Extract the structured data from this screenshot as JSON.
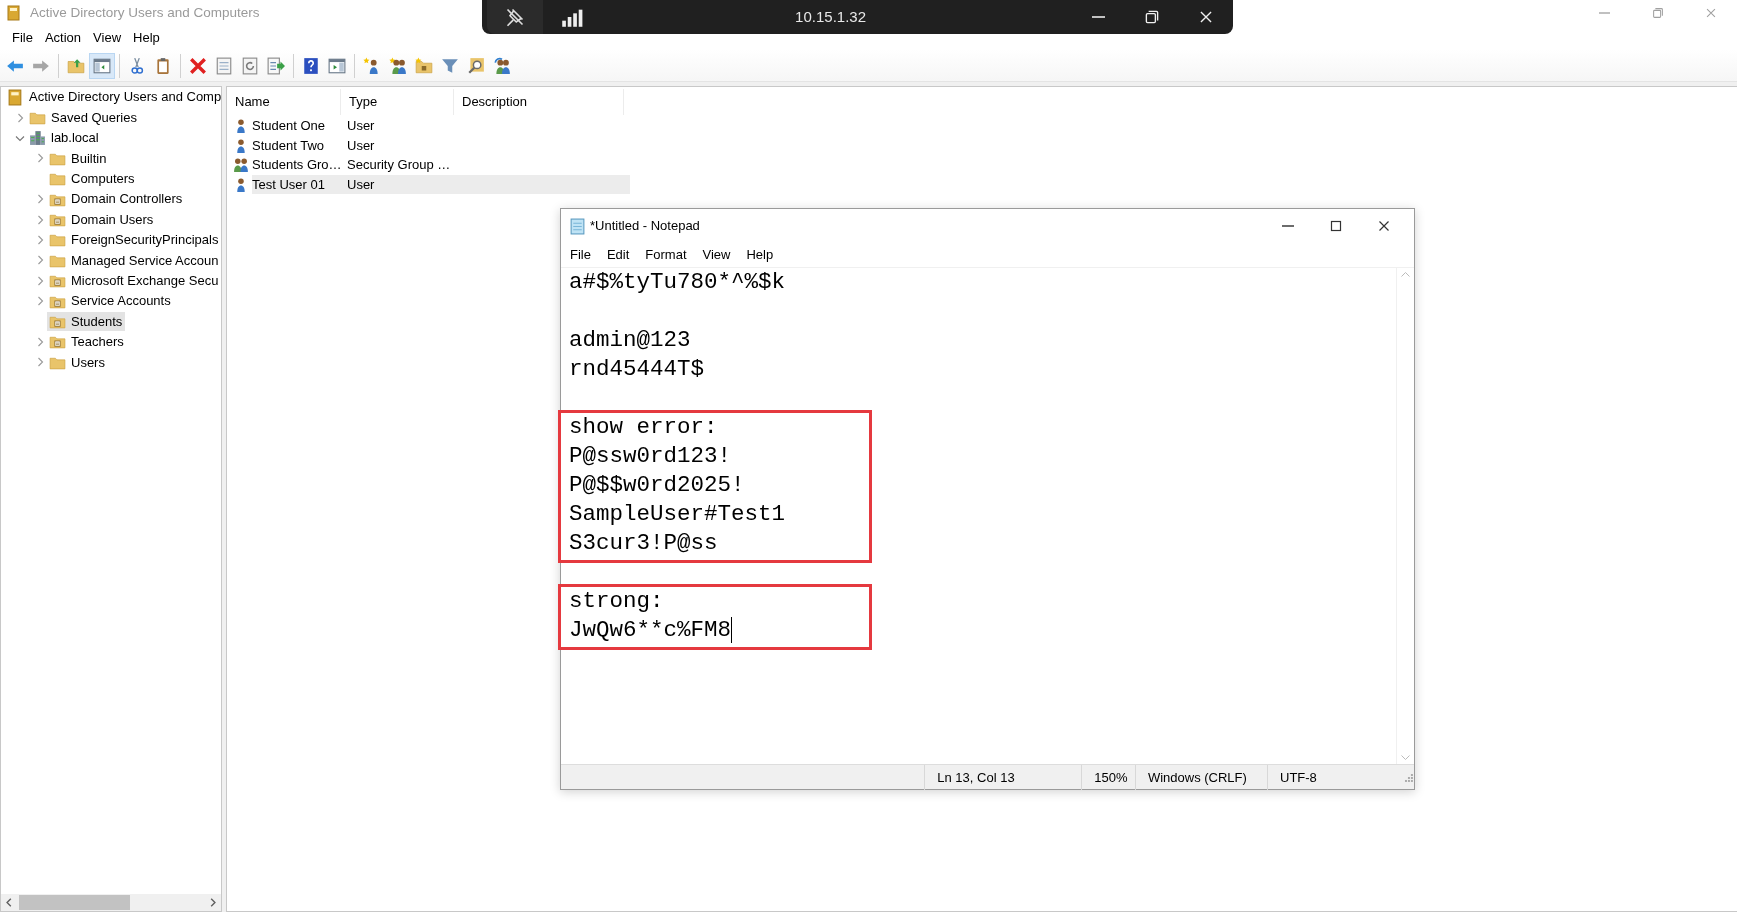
{
  "window": {
    "title": "Active Directory Users and Computers"
  },
  "remote_bar": {
    "address": "10.15.1.32"
  },
  "menu": [
    "File",
    "Action",
    "View",
    "Help"
  ],
  "toolbar_groups": [
    [
      {
        "kind": "back",
        "selected": false,
        "disabled": false
      },
      {
        "kind": "forward",
        "selected": false,
        "disabled": true
      }
    ],
    [
      {
        "kind": "up",
        "selected": false,
        "disabled": false
      },
      {
        "kind": "tree",
        "selected": true,
        "disabled": false
      }
    ],
    [
      {
        "kind": "cut",
        "selected": false,
        "disabled": false
      },
      {
        "kind": "paste",
        "selected": false,
        "disabled": false
      }
    ],
    [
      {
        "kind": "delete",
        "selected": false,
        "disabled": false
      },
      {
        "kind": "properties",
        "selected": false,
        "disabled": false
      },
      {
        "kind": "refresh",
        "selected": false,
        "disabled": false
      },
      {
        "kind": "export",
        "selected": false,
        "disabled": false
      }
    ],
    [
      {
        "kind": "help",
        "selected": false,
        "disabled": false
      },
      {
        "kind": "showpane",
        "selected": false,
        "disabled": false
      }
    ],
    [
      {
        "kind": "newuser",
        "selected": false,
        "disabled": false
      },
      {
        "kind": "newgroup",
        "selected": false,
        "disabled": false
      },
      {
        "kind": "newou",
        "selected": false,
        "disabled": false
      },
      {
        "kind": "filter",
        "selected": false,
        "disabled": false
      },
      {
        "kind": "find",
        "selected": false,
        "disabled": false
      },
      {
        "kind": "addgroup",
        "selected": false,
        "disabled": false
      }
    ]
  ],
  "tree": {
    "label": "Active Directory Users and Comp",
    "kind": "snapin",
    "selected": false,
    "children": [
      {
        "label": "Saved Queries",
        "kind": "folder",
        "expanded": false,
        "selected": false
      },
      {
        "label": "lab.local",
        "kind": "domain",
        "expanded": true,
        "selected": false,
        "children": [
          {
            "label": "Builtin",
            "kind": "folder",
            "expanded": false,
            "selected": false
          },
          {
            "label": "Computers",
            "kind": "folder",
            "selected": false
          },
          {
            "label": "Domain Controllers",
            "kind": "ou",
            "expanded": false,
            "selected": false
          },
          {
            "label": "Domain Users",
            "kind": "ou",
            "expanded": false,
            "selected": false
          },
          {
            "label": "ForeignSecurityPrincipals",
            "kind": "folder",
            "expanded": false,
            "selected": false
          },
          {
            "label": "Managed Service Accoun",
            "kind": "folder",
            "expanded": false,
            "selected": false
          },
          {
            "label": "Microsoft Exchange Secu",
            "kind": "ou",
            "expanded": false,
            "selected": false
          },
          {
            "label": "Service Accounts",
            "kind": "ou",
            "expanded": false,
            "selected": false
          },
          {
            "label": "Students",
            "kind": "ou",
            "selected": true
          },
          {
            "label": "Teachers",
            "kind": "ou",
            "expanded": false,
            "selected": false
          },
          {
            "label": "Users",
            "kind": "folder",
            "expanded": false,
            "selected": false
          }
        ]
      }
    ]
  },
  "list": {
    "columns": [
      "Name",
      "Type",
      "Description"
    ],
    "rows": [
      {
        "name": "Student One",
        "type": "User",
        "kind": "user",
        "selected": false
      },
      {
        "name": "Student Two",
        "type": "User",
        "kind": "user",
        "selected": false
      },
      {
        "name": "Students Gro…",
        "type": "Security Group …",
        "kind": "group",
        "selected": false
      },
      {
        "name": "Test User 01",
        "type": "User",
        "kind": "user",
        "selected": true
      }
    ]
  },
  "notepad": {
    "title": "*Untitled - Notepad",
    "menu": [
      "File",
      "Edit",
      "Format",
      "View",
      "Help"
    ],
    "blocks": [
      {
        "lines": [
          "a#$%tyTu780*^%$k"
        ],
        "boxed": false
      },
      {
        "lines": [
          "admin@123",
          "rnd45444T$"
        ],
        "boxed": false
      },
      {
        "lines": [
          "show error:",
          "P@ssw0rd123!",
          "P@$$w0rd2025!",
          "SampleUser#Test1",
          "S3cur3!P@ss"
        ],
        "boxed": true
      },
      {
        "lines": [
          "strong:",
          "JwQw6**c%FM8"
        ],
        "boxed": true
      }
    ],
    "status": [
      "Ln 13, Col 13",
      "150%",
      "Windows (CRLF)",
      "UTF-8"
    ]
  }
}
